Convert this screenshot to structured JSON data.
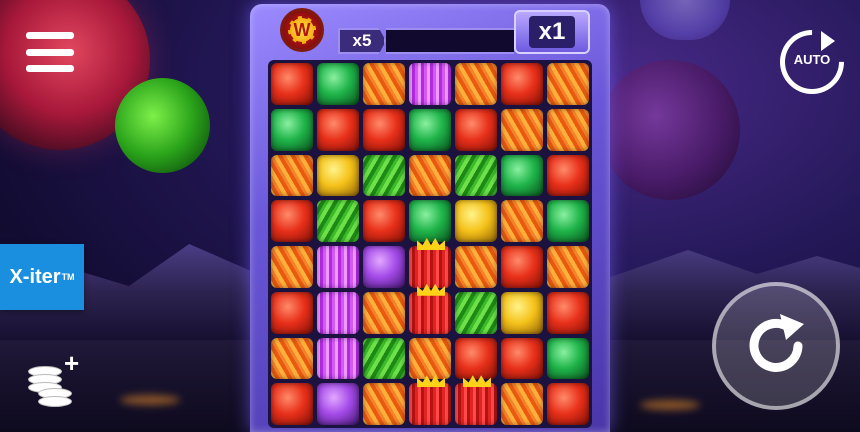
{
  "game": {
    "w_badge": "W",
    "multiplier_small": "x5",
    "multiplier_big": "x1",
    "auto_label": "AUTO",
    "xiter_label": "X-iter",
    "xiter_tm": "TM",
    "coins_plus": "+"
  },
  "grid": [
    [
      "gem-red",
      "gem-green",
      "fur-orange",
      "fur-purple",
      "fur-orange",
      "gem-red",
      "fur-orange"
    ],
    [
      "gem-green",
      "gem-red",
      "gem-red",
      "gem-green",
      "gem-red",
      "fur-orange",
      "fur-orange"
    ],
    [
      "fur-orange",
      "gem-yellow",
      "fur-green",
      "fur-orange",
      "fur-green",
      "gem-green",
      "gem-red"
    ],
    [
      "gem-red",
      "fur-green",
      "gem-red",
      "gem-green",
      "gem-yellow",
      "fur-orange",
      "gem-green"
    ],
    [
      "fur-orange",
      "fur-purple",
      "gem-purple",
      "fur-red-crown",
      "fur-orange",
      "gem-red",
      "fur-orange"
    ],
    [
      "gem-red",
      "fur-purple",
      "fur-orange",
      "fur-red-crown",
      "fur-green",
      "gem-yellow",
      "gem-red"
    ],
    [
      "fur-orange",
      "fur-purple",
      "fur-green",
      "fur-orange",
      "gem-red",
      "gem-red",
      "gem-green"
    ],
    [
      "gem-red",
      "gem-purple",
      "fur-orange",
      "fur-red-crown",
      "fur-red-crown",
      "fur-orange",
      "gem-red"
    ]
  ]
}
